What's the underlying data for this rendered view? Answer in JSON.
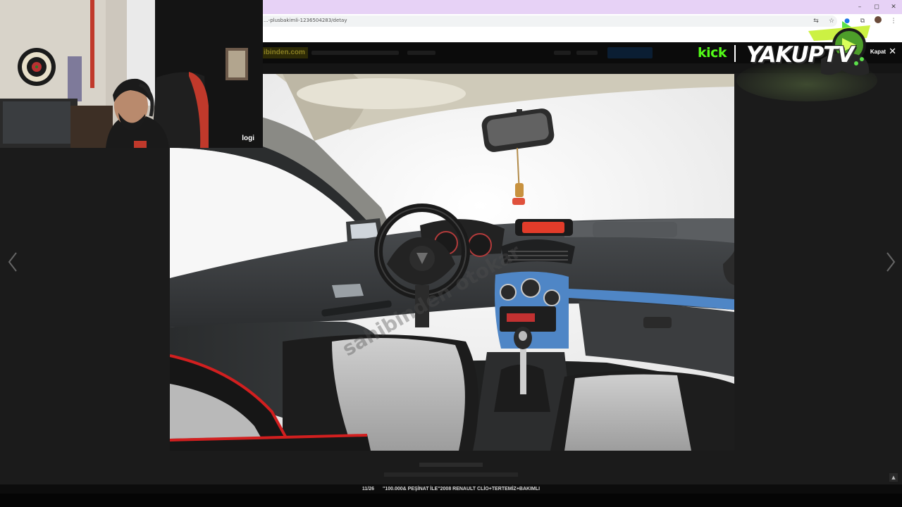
{
  "browser": {
    "url": "...-plusbakimli-1236504283/detay",
    "window_controls": [
      "–",
      "◻",
      "✕"
    ],
    "toolbar_icons": [
      "translate-icon",
      "star-icon",
      "extension-g-icon",
      "extensions-icon",
      "profile-avatar",
      "menu-icon"
    ]
  },
  "site": {
    "logo_text": "ibinden.com"
  },
  "gallery": {
    "counter": "11/26",
    "title": "\"100.000& PEŞİNAT İLE\"2008 RENAULT CLİO+TERTEMİZ+BAKIMLI",
    "close_label": "Kapat",
    "watermark": "sahibinden otokar"
  },
  "overlay": {
    "webcam_brand": "logi",
    "kick_label": "kick",
    "channel_name": "YAKUPTV"
  },
  "colors": {
    "kick_green": "#53fc18",
    "titlebar": "#e7d2f6",
    "backdrop": "#1b1b1b",
    "dash_blue": "#4f86c6"
  }
}
